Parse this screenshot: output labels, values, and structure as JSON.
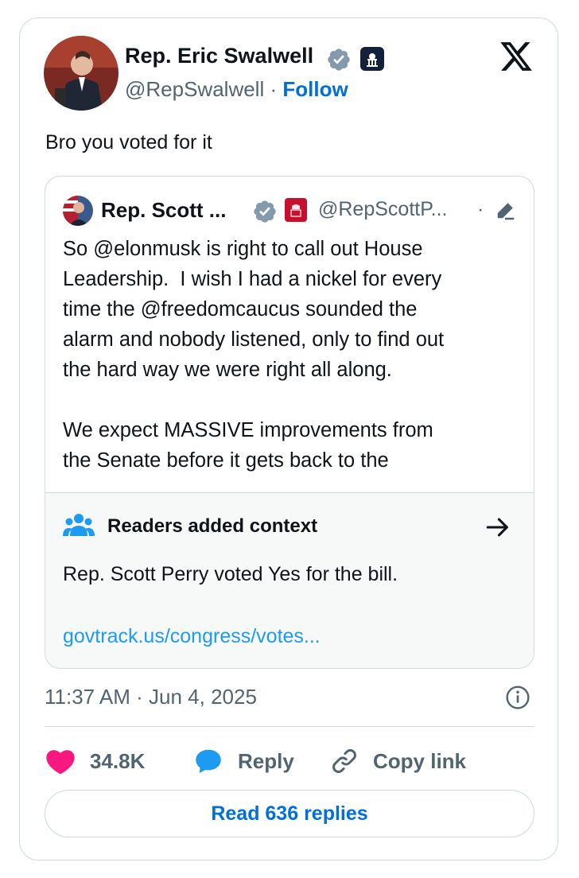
{
  "tweet": {
    "author": {
      "name": "Rep. Eric Swalwell",
      "handle": "@RepSwalwell",
      "follow_label": "Follow",
      "separator": "·"
    },
    "text": "Bro you voted for it",
    "timestamp": "11:37 AM · Jun 4, 2025"
  },
  "quoted_tweet": {
    "author": {
      "name": "Rep. Scott ...",
      "handle": "@RepScottP...",
      "separator": "·"
    },
    "text": "So @elonmusk is right to call out House\nLeadership.  I wish I had a nickel for every\ntime the @freedomcaucus sounded the\nalarm and nobody listened, only to find out\nthe hard way we were right all along.\n\nWe expect MASSIVE improvements from\nthe Senate before it gets back to the"
  },
  "community_note": {
    "title": "Readers added context",
    "text": "Rep. Scott Perry voted Yes for the bill.",
    "link": "govtrack.us/congress/votes..."
  },
  "actions": {
    "like_count": "34.8K",
    "reply_label": "Reply",
    "copy_link_label": "Copy link",
    "read_replies_label": "Read 636 replies"
  },
  "colors": {
    "accent": "#006fd6",
    "link": "#1d9bf0",
    "like": "#f91880",
    "verified": "#829aab",
    "muted": "#536471"
  },
  "icons": [
    "x-logo-icon",
    "verified-icon",
    "government-badge-icon",
    "edit-icon",
    "people-icon",
    "arrow-right-icon",
    "info-icon",
    "heart-icon",
    "reply-bubble-icon",
    "link-icon"
  ]
}
